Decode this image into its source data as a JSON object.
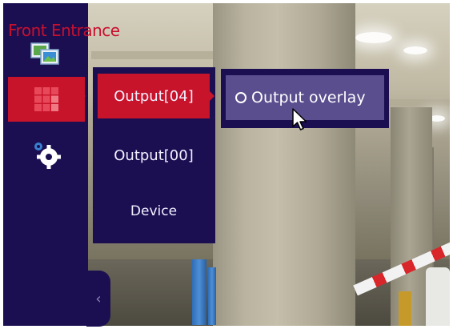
{
  "camera": {
    "title": "Front Entrance"
  },
  "sidebar": {
    "items": [
      {
        "icon": "live-view-icon"
      },
      {
        "icon": "output-grid-icon",
        "active": true
      },
      {
        "icon": "settings-gear-icon"
      }
    ],
    "collapse_label": "‹"
  },
  "submenu": {
    "items": [
      {
        "label": "Output[04]",
        "active": true
      },
      {
        "label": "Output[00]"
      },
      {
        "label": "Device"
      }
    ]
  },
  "flyout": {
    "option_label": "Output overlay",
    "checked": false
  },
  "colors": {
    "panel": "#1b0f52",
    "accent": "#c8142a",
    "highlight": "#5a4e8e",
    "title": "#c8102e"
  }
}
